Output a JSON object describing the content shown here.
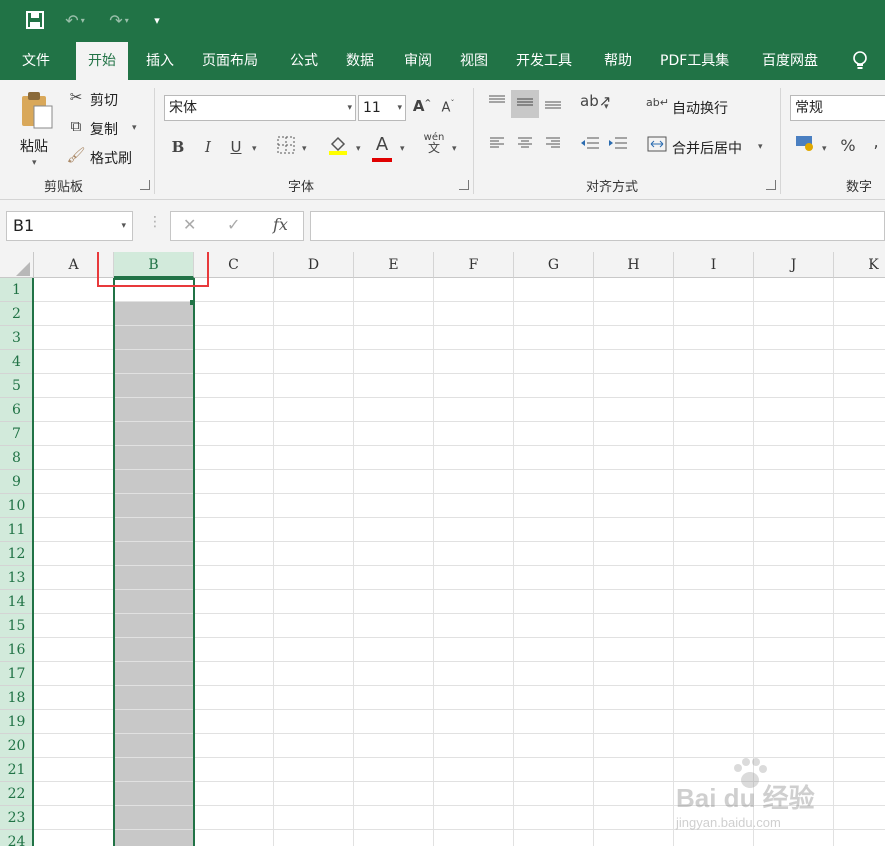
{
  "qat": {
    "save": "💾",
    "undo": "↶",
    "redo": "↷",
    "customize": "▾"
  },
  "tabs": [
    "文件",
    "开始",
    "插入",
    "页面布局",
    "公式",
    "数据",
    "审阅",
    "视图",
    "开发工具",
    "帮助",
    "PDF工具集",
    "百度网盘"
  ],
  "active_tab": "开始",
  "tell_me_icon": "lightbulb-icon",
  "clipboard": {
    "paste": "粘贴",
    "cut": "剪切",
    "copy": "复制",
    "format_painter": "格式刷",
    "group": "剪贴板"
  },
  "font": {
    "name": "宋体",
    "size": "11",
    "bold": "B",
    "italic": "I",
    "underline": "U",
    "fill_color": "#ffff00",
    "font_color": "#e00000",
    "font_color_glyph": "A",
    "phonetic_top": "wén",
    "phonetic_bottom": "文",
    "group": "字体"
  },
  "alignment": {
    "wrap_text": "自动换行",
    "merge_center": "合并后居中",
    "group": "对齐方式"
  },
  "number": {
    "format": "常规",
    "percent": "%",
    "comma": ",",
    "group": "数字"
  },
  "formula_bar": {
    "name_box": "B1",
    "cancel": "✕",
    "enter": "✓",
    "fx": "fx",
    "value": ""
  },
  "grid": {
    "columns": [
      "A",
      "B",
      "C",
      "D",
      "E",
      "F",
      "G",
      "H",
      "I",
      "J",
      "K"
    ],
    "rows": [
      "1",
      "2",
      "3",
      "4",
      "5",
      "6",
      "7",
      "8",
      "9",
      "10",
      "11",
      "12",
      "13",
      "14",
      "15",
      "16",
      "17",
      "18",
      "19",
      "20",
      "21",
      "22",
      "23",
      "24"
    ],
    "selected_column": "B",
    "active_cell": "B1"
  },
  "colors": {
    "brand": "#217346",
    "selection_fill": "#c8c8c8",
    "highlight_box": "#e8393b"
  },
  "watermark": "Bai du 经验 jingyan.baidu.com"
}
